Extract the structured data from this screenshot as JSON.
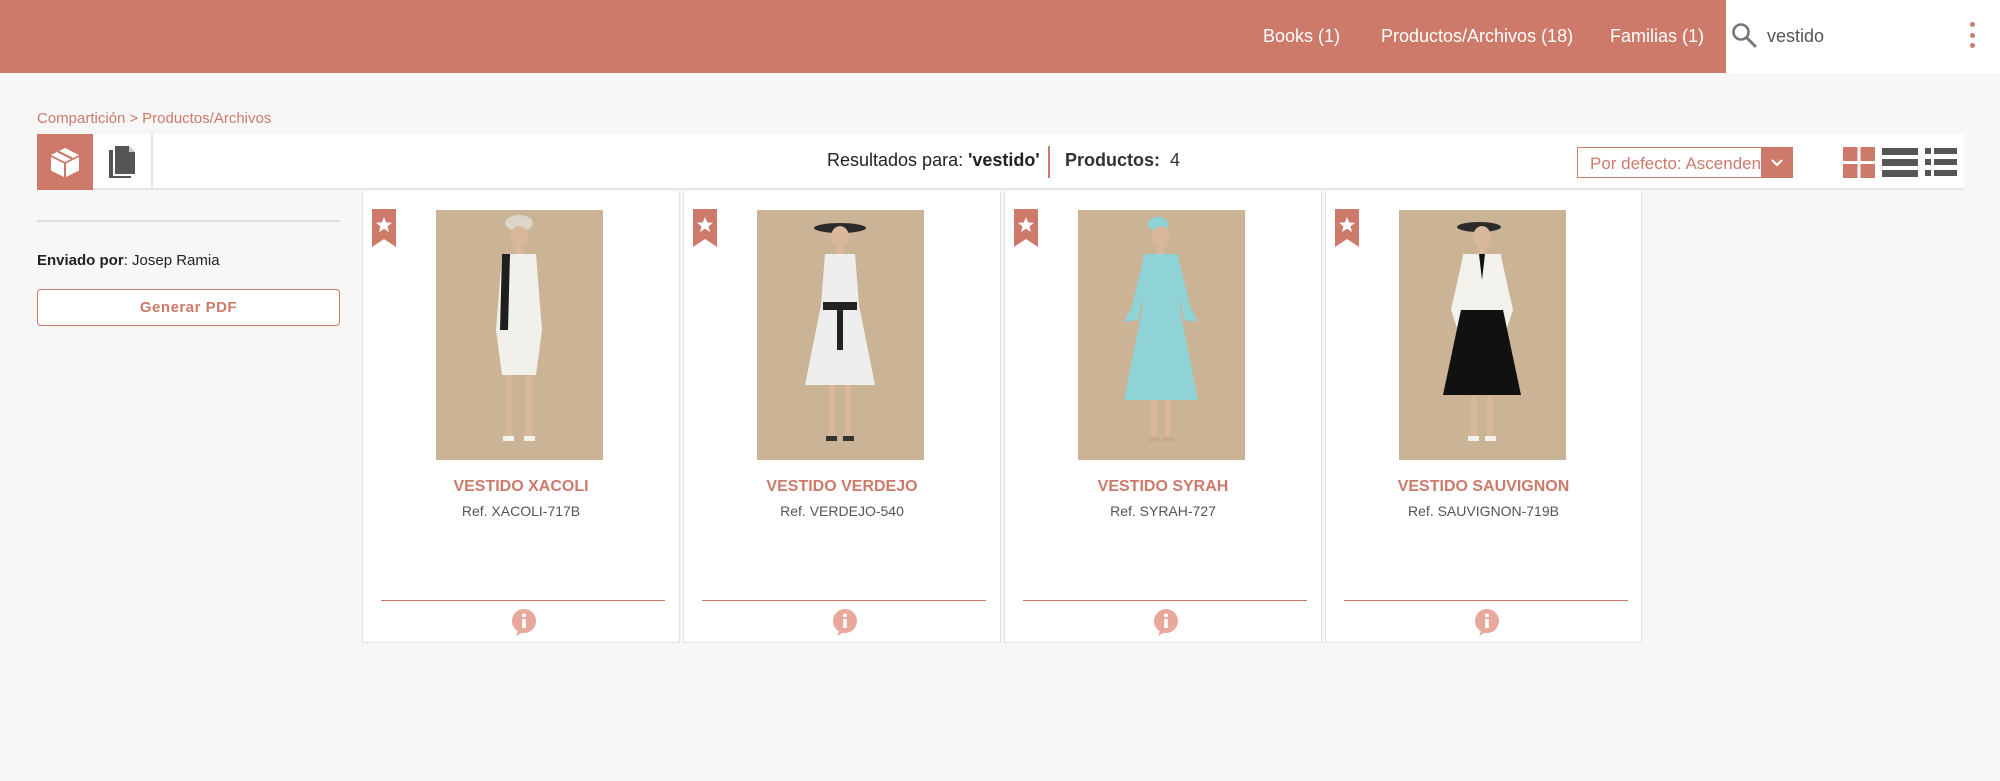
{
  "header": {
    "nav": [
      {
        "label": "Books (1)"
      },
      {
        "label": "Productos/Archivos (18)"
      },
      {
        "label": "Familias (1)"
      }
    ],
    "search": {
      "value": "vestido"
    }
  },
  "breadcrumb": {
    "root": "Compartición",
    "separator": ">",
    "current": "Productos/Archivos"
  },
  "toolbar": {
    "results_label": "Resultados para:",
    "results_query": "'vestido'",
    "products_label": "Productos:",
    "products_count": "4",
    "sort_label": "Por defecto: Ascendente"
  },
  "sidebar": {
    "sender_label": "Enviado por",
    "sender_name": ": Josep Ramia",
    "pdf_button": "Generar PDF"
  },
  "products": [
    {
      "name": "VESTIDO XACOLI",
      "ref": "Ref. XACOLI-717B",
      "dress_color": "#f2f0ea",
      "accent": "#1e1e1e"
    },
    {
      "name": "VESTIDO VERDEJO",
      "ref": "Ref. VERDEJO-540",
      "dress_color": "#eeeeee",
      "accent": "#222222"
    },
    {
      "name": "VESTIDO SYRAH",
      "ref": "Ref. SYRAH-727",
      "dress_color": "#8fd3d6",
      "accent": "#8fd3d6"
    },
    {
      "name": "VESTIDO SAUVIGNON",
      "ref": "Ref. SAUVIGNON-719B",
      "dress_color": "#111111",
      "accent": "#f3f1ec"
    }
  ],
  "colors": {
    "brand": "#cd7a6b",
    "photo_bg": "#cbb395"
  },
  "icons": {
    "products_tab": "box-icon",
    "files_tab": "document-icon",
    "search": "search-icon",
    "menu": "kebab-menu-icon",
    "bookmark": "star-bookmark-icon",
    "info": "info-icon"
  }
}
